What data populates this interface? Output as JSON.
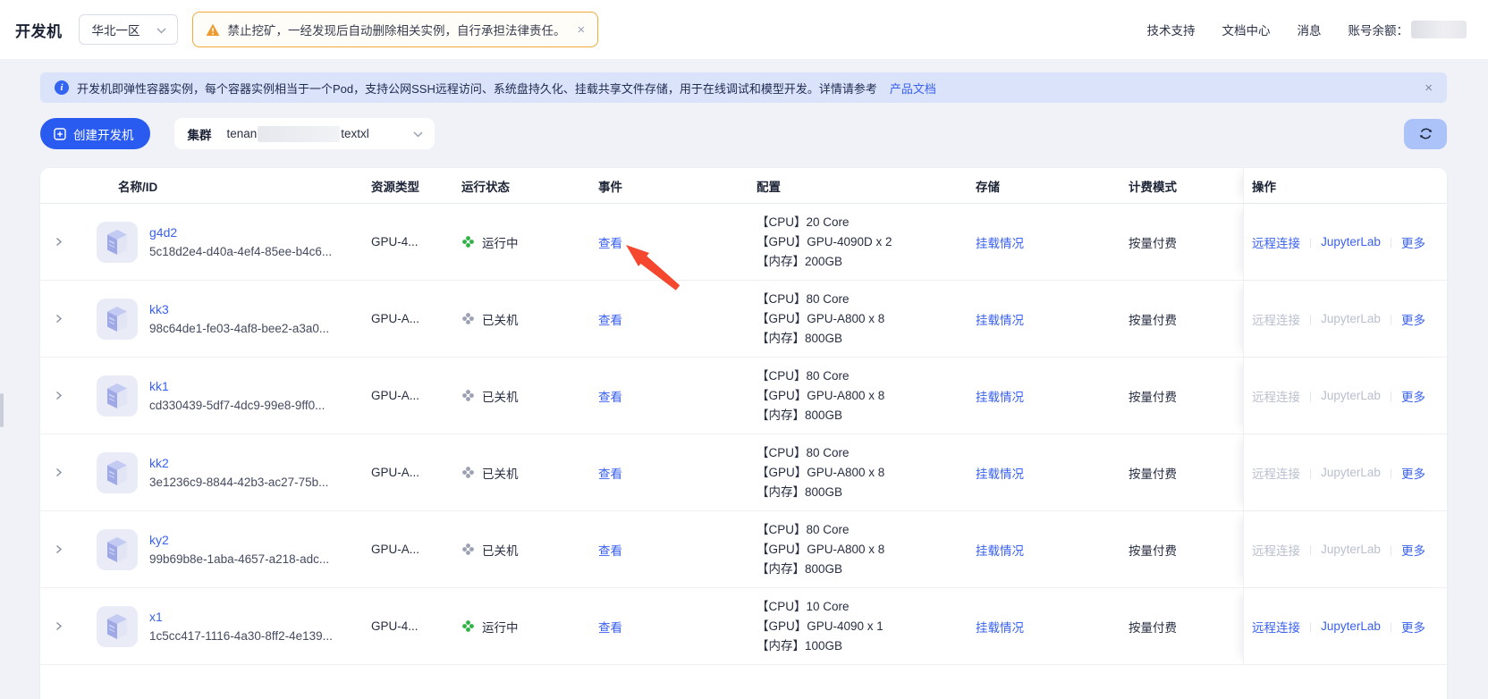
{
  "topbar": {
    "app_title": "开发机",
    "region": "华北一区",
    "warning_text": "禁止挖矿，一经发现后自动删除相关实例，自行承担法律责任。",
    "warning_close": "×",
    "nav_links": {
      "support": "技术支持",
      "docs": "文档中心",
      "messages": "消息"
    },
    "balance_label": "账号余额："
  },
  "notice": {
    "text": "开发机即弹性容器实例，每个容器实例相当于一个Pod，支持公网SSH远程访问、系统盘持久化、挂载共享文件存储，用于在线调试和模型开发。详情请参考",
    "link": "产品文档",
    "close": "×"
  },
  "toolbar": {
    "create_label": "创建开发机",
    "cluster_label": "集群",
    "cluster_value_prefix": "tenan",
    "cluster_value_suffix": "textxl"
  },
  "table": {
    "columns": {
      "name": "名称/ID",
      "type": "资源类型",
      "status": "运行状态",
      "event": "事件",
      "config": "配置",
      "storage": "存储",
      "billing": "计费模式",
      "ops": "操作"
    },
    "event_link": "查看",
    "storage_link": "挂载情况",
    "ops_labels": {
      "remote": "远程连接",
      "jupyter": "JupyterLab",
      "more": "更多"
    },
    "ops_separator": "|",
    "rows": [
      {
        "name": "g4d2",
        "id": "5c18d2e4-d40a-4ef4-85ee-b4c6...",
        "type": "GPU-4...",
        "status_text": "运行中",
        "status_state": "running",
        "config": [
          "【CPU】20 Core",
          "【GPU】GPU-4090D x 2",
          "【内存】200GB"
        ],
        "billing": "按量付费"
      },
      {
        "name": "kk3",
        "id": "98c64de1-fe03-4af8-bee2-a3a0...",
        "type": "GPU-A...",
        "status_text": "已关机",
        "status_state": "stopped",
        "config": [
          "【CPU】80 Core",
          "【GPU】GPU-A800 x 8",
          "【内存】800GB"
        ],
        "billing": "按量付费"
      },
      {
        "name": "kk1",
        "id": "cd330439-5df7-4dc9-99e8-9ff0...",
        "type": "GPU-A...",
        "status_text": "已关机",
        "status_state": "stopped",
        "config": [
          "【CPU】80 Core",
          "【GPU】GPU-A800 x 8",
          "【内存】800GB"
        ],
        "billing": "按量付费"
      },
      {
        "name": "kk2",
        "id": "3e1236c9-8844-42b3-ac27-75b...",
        "type": "GPU-A...",
        "status_text": "已关机",
        "status_state": "stopped",
        "config": [
          "【CPU】80 Core",
          "【GPU】GPU-A800 x 8",
          "【内存】800GB"
        ],
        "billing": "按量付费"
      },
      {
        "name": "ky2",
        "id": "99b69b8e-1aba-4657-a218-adc...",
        "type": "GPU-A...",
        "status_text": "已关机",
        "status_state": "stopped",
        "config": [
          "【CPU】80 Core",
          "【GPU】GPU-A800 x 8",
          "【内存】800GB"
        ],
        "billing": "按量付费"
      },
      {
        "name": "x1",
        "id": "1c5cc417-1116-4a30-8ff2-4e139...",
        "type": "GPU-4...",
        "status_text": "运行中",
        "status_state": "running",
        "config": [
          "【CPU】10 Core",
          "【GPU】GPU-4090 x 1",
          "【内存】100GB"
        ],
        "billing": "按量付费"
      }
    ]
  },
  "icons": {
    "warning-icon": "⚠ orange triangle",
    "info-icon": "i in blue circle",
    "chevron-down-icon": "▾",
    "close-icon": "×",
    "plus-square-icon": "⊞",
    "refresh-icon": "⟳",
    "expand-chevron-icon": "›",
    "status-fan-icon": "✤ clover/fan",
    "machine-icon": "isometric server box",
    "red-arrow-annotation": "↖ red pointer arrow"
  },
  "colors": {
    "accent": "#2a5bf0",
    "link": "#3a61f0",
    "running": "#2fb344",
    "stopped": "#9ba1b3",
    "warning_border": "#f3a93c",
    "notice_bg": "#dbe3fb",
    "disabled_link": "#b9bfce",
    "arrow": "#f5462e",
    "page_bg": "#f0f2f8"
  }
}
